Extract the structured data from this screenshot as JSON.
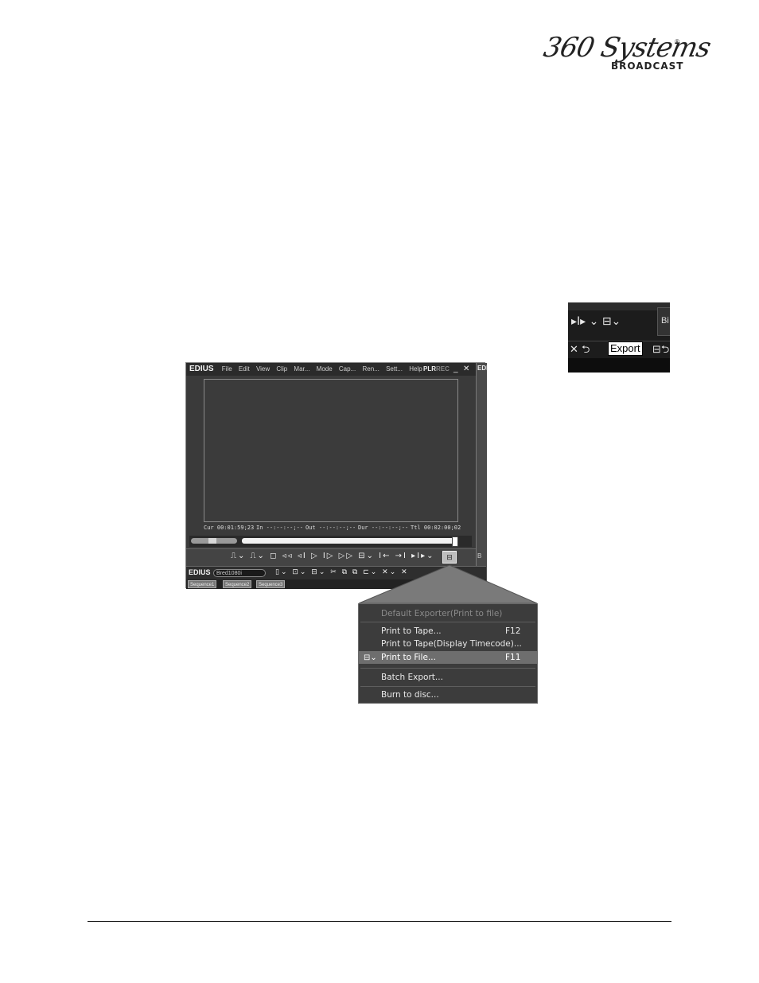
{
  "logo": {
    "script": "360 Systems",
    "sub": "BROADCAST",
    "reg": "®"
  },
  "inset": {
    "row1": "▸I▸ ⌄ ⊟⌄",
    "sidebox": "Bi",
    "left_glyphs": "✕  ⮌",
    "tooltip": "Export",
    "right_glyph": "⊟⮌"
  },
  "edius": {
    "brand": "EDIUS",
    "menus": [
      "File",
      "Edit",
      "View",
      "Clip",
      "Mar...",
      "Mode",
      "Cap...",
      "Ren...",
      "Sett...",
      "Help"
    ],
    "plr": "PLR",
    "rec": "REC",
    "minimize": "_",
    "close": "✕",
    "side_label": "EDI",
    "side_label2": "B",
    "timecodes": {
      "cur": "Cur 00:01:59;23",
      "in": "In --:--:--;--",
      "out": "Out --:--:--;--",
      "dur": "Dur --:--:--;--",
      "ttl": "Ttl 00:02:00;02"
    },
    "transport_glyphs": "⎍⌄ ⎍⌄ ◻ ◃◃ ◃I ▷ I▷ ▷▷ ⊟⌄ I← →I ▸I▸⌄",
    "export_icon": "⊟",
    "project_brand": "EDIUS",
    "project_name": "Bred1080i",
    "tools_glyphs": "▯⌄ ⊡⌄ ⊟⌄ ✂ ⧉ ⧉ ⊏⌄ ✕⌄ ✕",
    "sequences": [
      "Sequence1",
      "Sequence2",
      "Sequence3"
    ]
  },
  "menu": {
    "items": [
      {
        "label": "Default Exporter(Print to file)",
        "key": "",
        "disabled": true
      },
      {
        "label": "Print to Tape...",
        "key": "F12"
      },
      {
        "label": "Print to Tape(Display Timecode)...",
        "key": ""
      },
      {
        "label": "Print to File...",
        "key": "F11",
        "highlighted": true,
        "icon": "⊟⌄"
      },
      {
        "label": "Batch Export...",
        "key": ""
      },
      {
        "label": "Burn to disc...",
        "key": ""
      }
    ]
  }
}
